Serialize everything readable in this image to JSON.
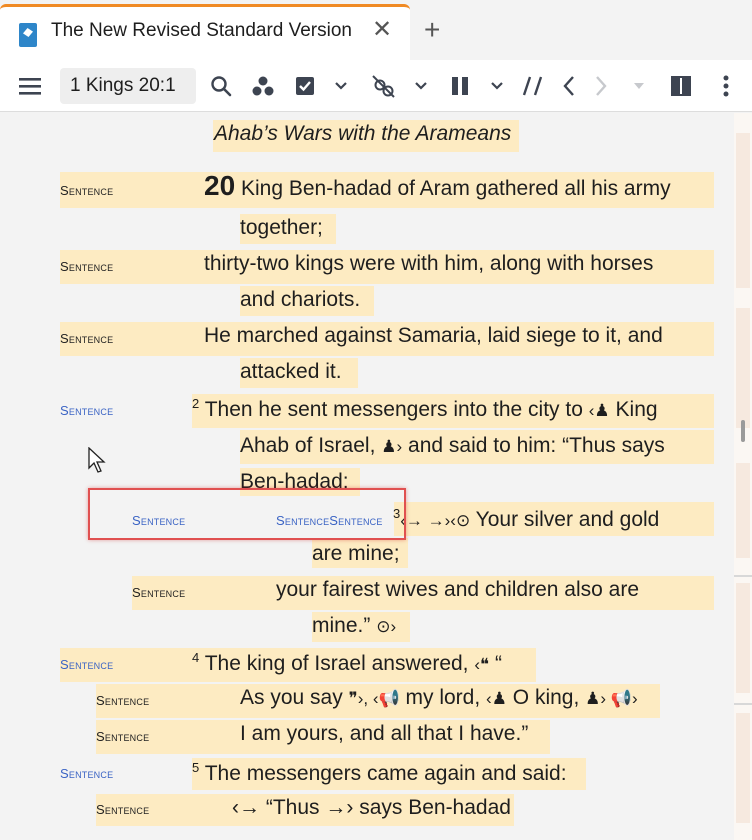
{
  "tab": {
    "title": "The New Revised Standard Version",
    "close": "✕",
    "new_tab": "+"
  },
  "toolbar": {
    "reference": "1 Kings 20:1"
  },
  "heading": "Ahab’s Wars with the Arameans",
  "label": "Sentence",
  "label_double": "SentenceSentence",
  "lines": {
    "l1a_num": "20",
    "l1a": "King Ben-hadad of Aram gathered all his army",
    "l1b": "together;",
    "l2a": "thirty-two kings were with him, along with horses",
    "l2b": "and chariots.",
    "l3a": "He marched against Samaria, laid siege to it, and",
    "l3b": "attacked it.",
    "l4a_num": "2",
    "l4a_text": "Then he sent messengers into the city to",
    "l4a_tail": "King",
    "l4b_text": "Ahab of Israel,",
    "l4b_tail": "and said to him: “Thus says",
    "l4c": "Ben-hadad:",
    "l5a_num": "3",
    "l5a_marks": "‹→ →›‹",
    "l5a_text": "Your silver and gold",
    "l5b": "are mine;",
    "l6a": "your fairest wives and children also are",
    "l6b": "mine.”",
    "l7_num": "4",
    "l7_text": "The king of Israel answered,",
    "l7_tail": "“",
    "l8_text": "As you say",
    "l8_mid": "my lord,",
    "l8_mid2": "O king,",
    "l9": "I am yours, and all that I have.”",
    "l10_num": "5",
    "l10": "The messengers came again and said:",
    "l11_a": "‹→ “Thus →›",
    "l11_b": "says Ben-hadad"
  },
  "colors": {
    "highlight": "#fdebc2",
    "label_blue": "#3a63c4",
    "tab_accent": "#f08a24",
    "red_box": "#e05050"
  },
  "icons": [
    "menu-icon",
    "search-icon",
    "people-icon",
    "checkbox-icon",
    "chevron-down-icon",
    "link-off-icon",
    "pause-icon",
    "parallel-icon",
    "back-icon",
    "forward-icon",
    "panel-icon",
    "more-icon"
  ]
}
